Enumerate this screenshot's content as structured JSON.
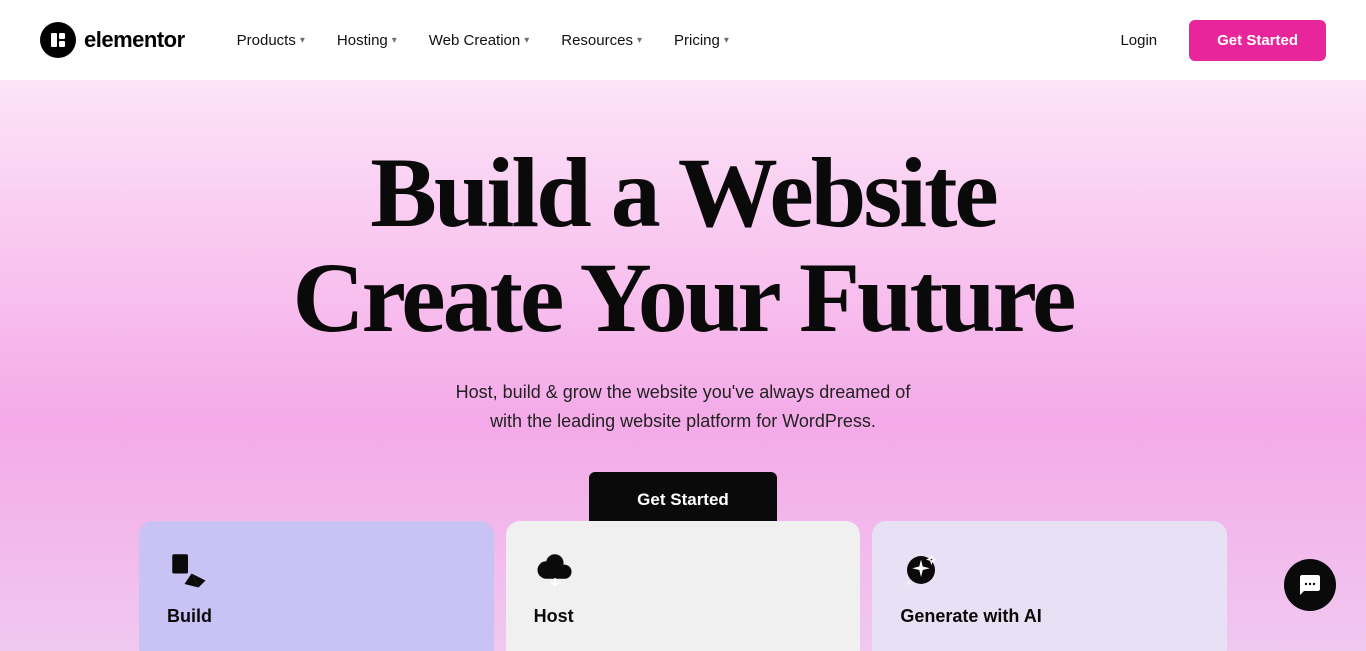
{
  "brand": {
    "name": "elementor",
    "logo_alt": "Elementor Logo"
  },
  "navbar": {
    "logo_text": "elementor",
    "login_label": "Login",
    "get_started_label": "Get Started",
    "menu_items": [
      {
        "id": "products",
        "label": "Products",
        "has_dropdown": true
      },
      {
        "id": "hosting",
        "label": "Hosting",
        "has_dropdown": true
      },
      {
        "id": "web-creation",
        "label": "Web Creation",
        "has_dropdown": true
      },
      {
        "id": "resources",
        "label": "Resources",
        "has_dropdown": true
      },
      {
        "id": "pricing",
        "label": "Pricing",
        "has_dropdown": true
      }
    ]
  },
  "hero": {
    "title_line1": "Build a Website",
    "title_line2": "Create Your Future",
    "subtitle_line1": "Host, build & grow the website you've always dreamed of",
    "subtitle_line2": "with the leading website platform for WordPress.",
    "cta_label": "Get Started"
  },
  "feature_cards": [
    {
      "id": "build",
      "label": "Build",
      "icon_type": "cursor-icon",
      "bg": "#c8c2f5"
    },
    {
      "id": "host",
      "label": "Host",
      "icon_type": "cloud-icon",
      "bg": "#f0f0f0"
    },
    {
      "id": "ai",
      "label": "Generate with AI",
      "icon_type": "ai-icon",
      "bg": "#e8e0f5"
    }
  ],
  "colors": {
    "hero_gradient_start": "#fce4f7",
    "hero_gradient_end": "#f0c8f0",
    "nav_cta_bg": "#e8259a",
    "hero_cta_bg": "#0a0a0a"
  }
}
